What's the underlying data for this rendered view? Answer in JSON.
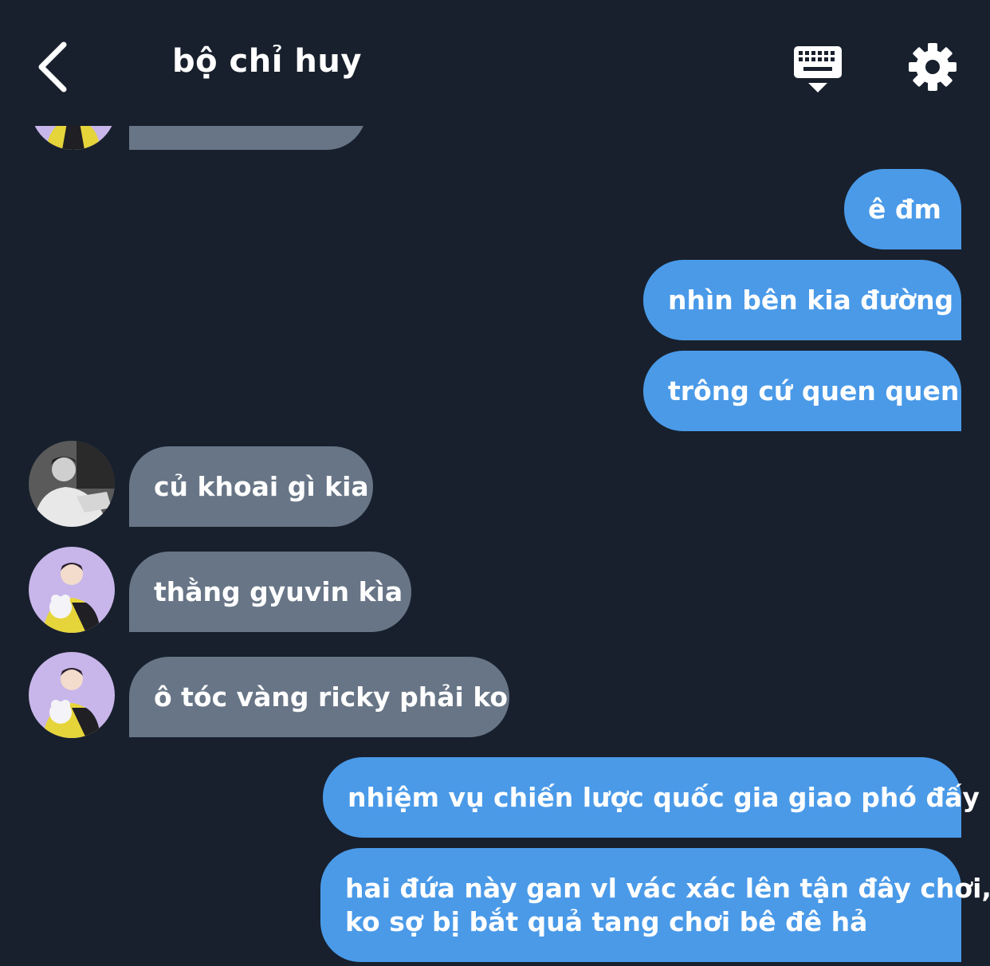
{
  "header": {
    "title": "bộ chỉ huy",
    "back_icon": "chevron-left-icon",
    "keyboard_icon": "keyboard-hide-icon",
    "settings_icon": "gear-icon"
  },
  "colors": {
    "background": "#18202d",
    "outgoing_bubble": "#4a9ae8",
    "incoming_bubble": "#677586",
    "text": "#ffffff"
  },
  "messages": [
    {
      "direction": "in",
      "text": "",
      "avatar": "avatar-purple-boy"
    },
    {
      "direction": "out",
      "text": "ê đm"
    },
    {
      "direction": "out",
      "text": "nhìn bên kia đường"
    },
    {
      "direction": "out",
      "text": "trông cứ quen quen"
    },
    {
      "direction": "in",
      "text": "củ khoai gì kia",
      "avatar": "avatar-bw-boy"
    },
    {
      "direction": "in",
      "text": "thằng gyuvin kìa",
      "avatar": "avatar-purple-boy"
    },
    {
      "direction": "in",
      "text": "ô tóc vàng ricky phải ko",
      "avatar": "avatar-purple-boy"
    },
    {
      "direction": "out",
      "text": "nhiệm vụ chiến lược quốc gia giao phó đấy"
    },
    {
      "direction": "out",
      "text": "hai đứa này gan vl vác xác lên tận đây chơi,",
      "text_line2": "ko sợ bị bắt quả tang chơi bê đê hả"
    }
  ]
}
